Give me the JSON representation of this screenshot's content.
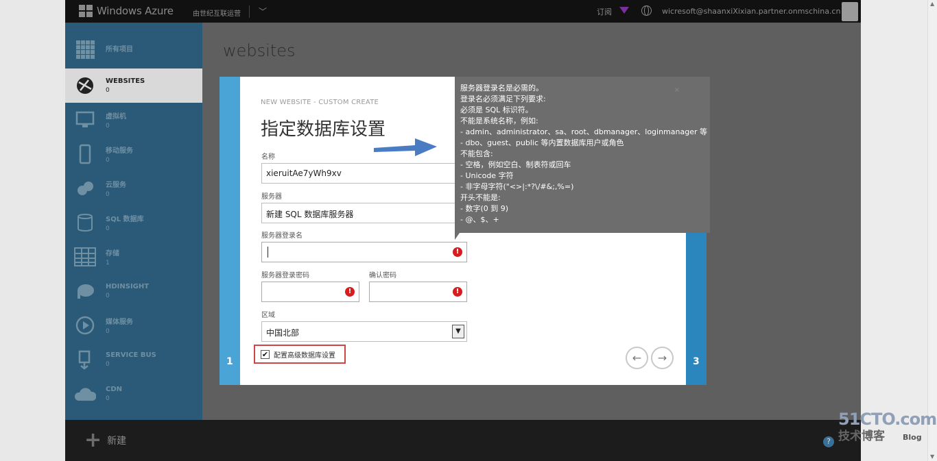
{
  "header": {
    "brand": "Windows Azure",
    "tenant": "由世纪互联运营",
    "subscribe": "订阅",
    "email": "wicresoft@shaanxiXixian.partner.onmschina.cn"
  },
  "nav": {
    "items": [
      {
        "label": "所有项目",
        "count": ""
      },
      {
        "label": "WEBSITES",
        "count": "0"
      },
      {
        "label": "虚拟机",
        "count": "0"
      },
      {
        "label": "移动服务",
        "count": "0"
      },
      {
        "label": "云服务",
        "count": "0"
      },
      {
        "label": "SQL 数据库",
        "count": "0"
      },
      {
        "label": "存储",
        "count": "1"
      },
      {
        "label": "HDINSIGHT",
        "count": "0"
      },
      {
        "label": "媒体服务",
        "count": "0"
      },
      {
        "label": "SERVICE BUS",
        "count": "0"
      },
      {
        "label": "CDN",
        "count": "0"
      }
    ]
  },
  "page": {
    "title": "websites"
  },
  "wizard": {
    "subtitle": "NEW WEBSITE - CUSTOM CREATE",
    "title": "指定数据库设置",
    "step_left": "1",
    "step_right": "3",
    "name_label": "名称",
    "name_value": "xieruitAe7yWh9xv",
    "server_label": "服务器",
    "server_value": "新建 SQL 数据库服务器",
    "login_label": "服务器登录名",
    "login_value": "",
    "password_label": "服务器登录密码",
    "confirm_label": "确认密码",
    "region_label": "区域",
    "region_value": "中国北部",
    "advanced_label": "配置高级数据库设置",
    "advanced_checked": "✔"
  },
  "tooltip": {
    "lines": [
      "服务器登录名是必需的。",
      "登录名必须满足下列要求:",
      "必须是 SQL 标识符。",
      "不能是系统名称，例如:",
      "- admin、administrator、sa、root、dbmanager、loginmanager 等",
      "- dbo、guest、public 等内置数据库用户或角色",
      "不能包含:",
      "- 空格，例如空白、制表符或回车",
      "- Unicode 字符",
      "- 非字母字符(\"<>|:*?\\/#&;,%=)",
      "开头不能是:",
      "- 数字(0 到 9)",
      "- @、$、+"
    ],
    "close": "×"
  },
  "bottombar": {
    "new_label": "新建",
    "help": "?"
  },
  "watermark": {
    "top": "51CTO.com",
    "bottom": "技术博客",
    "blog": "Blog"
  },
  "colors": {
    "nav_bg": "#2a5a78",
    "step_left": "#4aa4d6",
    "step_right": "#2a86bd",
    "error": "#d51d20",
    "highlight": "#d14242"
  }
}
